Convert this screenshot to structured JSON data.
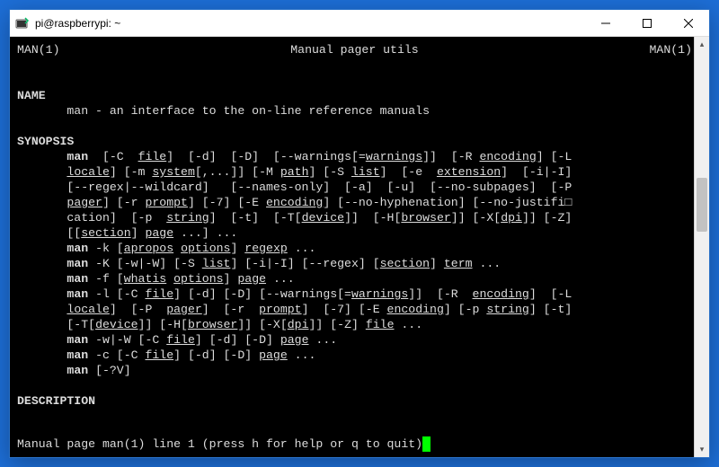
{
  "window": {
    "title": "pi@raspberrypi: ~"
  },
  "man": {
    "header_left": "MAN(1)",
    "header_center": "Manual pager utils",
    "header_right": "MAN(1)",
    "name_heading": "NAME",
    "name_text": "man - an interface to the on-line reference manuals",
    "synopsis_heading": "SYNOPSIS",
    "description_heading": "DESCRIPTION",
    "status_line": " Manual page man(1) line 1 (press h for help or q to quit)",
    "synopsis_lines": [
      [
        {
          "t": "       "
        },
        {
          "t": "man",
          "b": true
        },
        {
          "t": "  [-C  "
        },
        {
          "t": "file",
          "u": true
        },
        {
          "t": "]  [-d]  [-D]  [--warnings[="
        },
        {
          "t": "warnings",
          "u": true
        },
        {
          "t": "]]  [-R "
        },
        {
          "t": "encoding",
          "u": true
        },
        {
          "t": "] [-L"
        }
      ],
      [
        {
          "t": "       "
        },
        {
          "t": "locale",
          "u": true
        },
        {
          "t": "] [-m "
        },
        {
          "t": "system",
          "u": true
        },
        {
          "t": "[,...]] [-M "
        },
        {
          "t": "path",
          "u": true
        },
        {
          "t": "] [-S "
        },
        {
          "t": "list",
          "u": true
        },
        {
          "t": "]  [-e  "
        },
        {
          "t": "extension",
          "u": true
        },
        {
          "t": "]  [-i|-I]"
        }
      ],
      [
        {
          "t": "       [--regex|--wildcard]   [--names-only]  [-a]  [-u]  [--no-subpages]  [-P"
        }
      ],
      [
        {
          "t": "       "
        },
        {
          "t": "pager",
          "u": true
        },
        {
          "t": "] [-r "
        },
        {
          "t": "prompt",
          "u": true
        },
        {
          "t": "] [-7] [-E "
        },
        {
          "t": "encoding",
          "u": true
        },
        {
          "t": "] [--no-hyphenation] [--no-justifi□"
        }
      ],
      [
        {
          "t": "       cation]  [-p  "
        },
        {
          "t": "string",
          "u": true
        },
        {
          "t": "]  [-t]  [-T["
        },
        {
          "t": "device",
          "u": true
        },
        {
          "t": "]]  [-H["
        },
        {
          "t": "browser",
          "u": true
        },
        {
          "t": "]] [-X["
        },
        {
          "t": "dpi",
          "u": true
        },
        {
          "t": "]] [-Z]"
        }
      ],
      [
        {
          "t": "       [["
        },
        {
          "t": "section",
          "u": true
        },
        {
          "t": "] "
        },
        {
          "t": "page",
          "u": true
        },
        {
          "t": " ...] ..."
        }
      ],
      [
        {
          "t": "       "
        },
        {
          "t": "man",
          "b": true
        },
        {
          "t": " -k ["
        },
        {
          "t": "apropos",
          "u": true
        },
        {
          "t": " "
        },
        {
          "t": "options",
          "u": true
        },
        {
          "t": "] "
        },
        {
          "t": "regexp",
          "u": true
        },
        {
          "t": " ..."
        }
      ],
      [
        {
          "t": "       "
        },
        {
          "t": "man",
          "b": true
        },
        {
          "t": " -K [-w|-W] [-S "
        },
        {
          "t": "list",
          "u": true
        },
        {
          "t": "] [-i|-I] [--regex] ["
        },
        {
          "t": "section",
          "u": true
        },
        {
          "t": "] "
        },
        {
          "t": "term",
          "u": true
        },
        {
          "t": " ..."
        }
      ],
      [
        {
          "t": "       "
        },
        {
          "t": "man",
          "b": true
        },
        {
          "t": " -f ["
        },
        {
          "t": "whatis",
          "u": true
        },
        {
          "t": " "
        },
        {
          "t": "options",
          "u": true
        },
        {
          "t": "] "
        },
        {
          "t": "page",
          "u": true
        },
        {
          "t": " ..."
        }
      ],
      [
        {
          "t": "       "
        },
        {
          "t": "man",
          "b": true
        },
        {
          "t": " -l [-C "
        },
        {
          "t": "file",
          "u": true
        },
        {
          "t": "] [-d] [-D] [--warnings[="
        },
        {
          "t": "warnings",
          "u": true
        },
        {
          "t": "]]  [-R  "
        },
        {
          "t": "encoding",
          "u": true
        },
        {
          "t": "]  [-L"
        }
      ],
      [
        {
          "t": "       "
        },
        {
          "t": "locale",
          "u": true
        },
        {
          "t": "]  [-P  "
        },
        {
          "t": "pager",
          "u": true
        },
        {
          "t": "]  [-r  "
        },
        {
          "t": "prompt",
          "u": true
        },
        {
          "t": "]  [-7] [-E "
        },
        {
          "t": "encoding",
          "u": true
        },
        {
          "t": "] [-p "
        },
        {
          "t": "string",
          "u": true
        },
        {
          "t": "] [-t]"
        }
      ],
      [
        {
          "t": "       [-T["
        },
        {
          "t": "device",
          "u": true
        },
        {
          "t": "]] [-H["
        },
        {
          "t": "browser",
          "u": true
        },
        {
          "t": "]] [-X["
        },
        {
          "t": "dpi",
          "u": true
        },
        {
          "t": "]] [-Z] "
        },
        {
          "t": "file",
          "u": true
        },
        {
          "t": " ..."
        }
      ],
      [
        {
          "t": "       "
        },
        {
          "t": "man",
          "b": true
        },
        {
          "t": " -w|-W [-C "
        },
        {
          "t": "file",
          "u": true
        },
        {
          "t": "] [-d] [-D] "
        },
        {
          "t": "page",
          "u": true
        },
        {
          "t": " ..."
        }
      ],
      [
        {
          "t": "       "
        },
        {
          "t": "man",
          "b": true
        },
        {
          "t": " -c [-C "
        },
        {
          "t": "file",
          "u": true
        },
        {
          "t": "] [-d] [-D] "
        },
        {
          "t": "page",
          "u": true
        },
        {
          "t": " ..."
        }
      ],
      [
        {
          "t": "       "
        },
        {
          "t": "man",
          "b": true
        },
        {
          "t": " [-?V]"
        }
      ]
    ]
  }
}
